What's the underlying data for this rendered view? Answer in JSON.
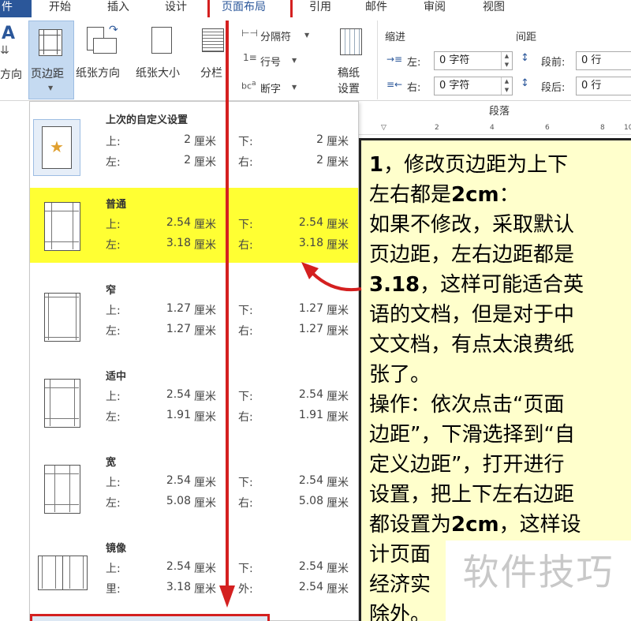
{
  "tabs": {
    "file": "件",
    "home": "开始",
    "insert": "插入",
    "design": "设计",
    "layout": "页面布局",
    "references": "引用",
    "mailings": "邮件",
    "review": "审阅",
    "view": "视图"
  },
  "ribbon": {
    "text_direction": "方向",
    "text_direction_letter": "A",
    "margins": "页边距",
    "orientation": "纸张方向",
    "size": "纸张大小",
    "columns": "分栏",
    "breaks": "分隔符",
    "line_numbers": "行号",
    "hyphenation": "断字",
    "draft_line1": "稿纸",
    "draft_line2": "设置",
    "indent_header": "缩进",
    "spacing_header": "间距",
    "indent_left_label": "左:",
    "indent_left_value": "0 字符",
    "indent_right_label": "右:",
    "indent_right_value": "0 字符",
    "space_before_label": "段前:",
    "space_before_value": "0 行",
    "space_after_label": "段后:",
    "space_after_value": "0 行",
    "paragraph_group": "段落"
  },
  "margins_menu": [
    {
      "title": "上次的自定义设置",
      "l1": "上:",
      "v1": "2",
      "l2": "下:",
      "v2": "2",
      "l3": "左:",
      "v3": "2",
      "l4": "右:",
      "v4": "2",
      "unit": "厘米"
    },
    {
      "title": "普通",
      "l1": "上:",
      "v1": "2.54",
      "l2": "下:",
      "v2": "2.54",
      "l3": "左:",
      "v3": "3.18",
      "l4": "右:",
      "v4": "3.18",
      "unit": "厘米"
    },
    {
      "title": "窄",
      "l1": "上:",
      "v1": "1.27",
      "l2": "下:",
      "v2": "1.27",
      "l3": "左:",
      "v3": "1.27",
      "l4": "右:",
      "v4": "1.27",
      "unit": "厘米"
    },
    {
      "title": "适中",
      "l1": "上:",
      "v1": "2.54",
      "l2": "下:",
      "v2": "2.54",
      "l3": "左:",
      "v3": "1.91",
      "l4": "右:",
      "v4": "1.91",
      "unit": "厘米"
    },
    {
      "title": "宽",
      "l1": "上:",
      "v1": "2.54",
      "l2": "下:",
      "v2": "2.54",
      "l3": "左:",
      "v3": "5.08",
      "l4": "右:",
      "v4": "5.08",
      "unit": "厘米"
    },
    {
      "title": "镜像",
      "l1": "上:",
      "v1": "2.54",
      "l2": "下:",
      "v2": "2.54",
      "l3": "里:",
      "v3": "3.18",
      "l4": "外:",
      "v4": "2.54",
      "unit": "厘米"
    }
  ],
  "ruler": {
    "t2": "2",
    "t4": "4",
    "t6": "6",
    "t8": "8",
    "t10": "10"
  },
  "callout": {
    "l1a": "1",
    "l1b": "，修改页边距为上下",
    "l2a": "左右都是",
    "l2b": "2cm",
    "l2c": "：",
    "l3": "如果不修改，采取默认",
    "l4": "页边距，左右边距都是",
    "l5a": "3.18",
    "l5b": "，这样可能适合英",
    "l6": "语的文档，但是对于中",
    "l7": "文文档，有点太浪费纸",
    "l8": "张了。",
    "l9": "操作：依次点击“页面",
    "l10": "边距”，下滑选择到“自",
    "l11": "定义边距”，打开进行",
    "l12": "设置，把上下左右边距",
    "l13a": "都设置为",
    "l13b": "2cm",
    "l13c": "，这样设",
    "l14": "计页面",
    "l15": "经济实",
    "l16": "除外。"
  },
  "watermark": "软件技巧"
}
